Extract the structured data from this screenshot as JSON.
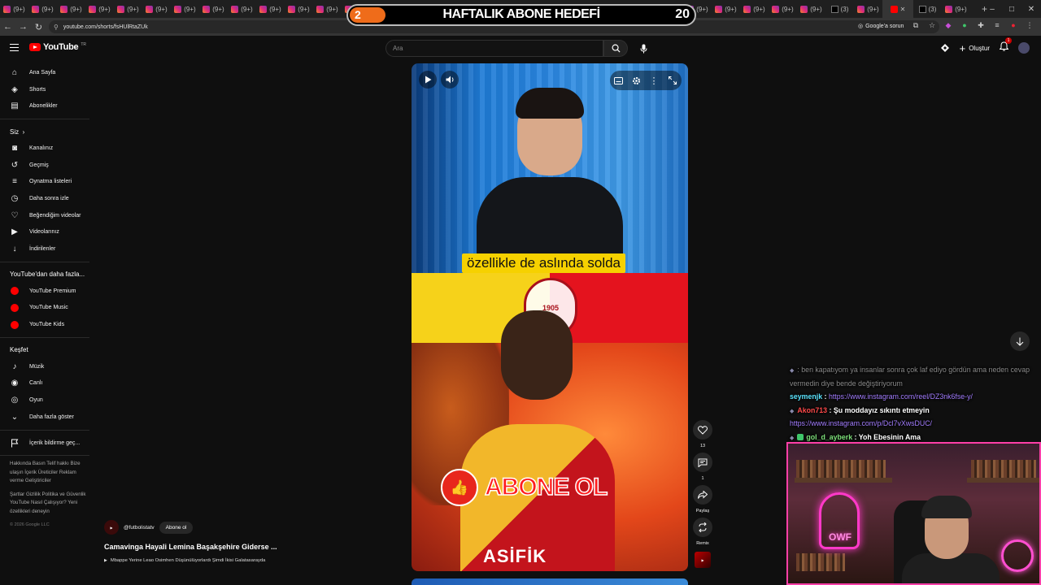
{
  "browser": {
    "tabs_count_label": "(9+)",
    "x_tab_label": "(3)",
    "url": "youtube.com/shorts/fsHUlRtaZUk",
    "google_issue": "Google'a sorun"
  },
  "overlay": {
    "goal_title": "HAFTALIK ABONE HEDEFİ",
    "current": "2",
    "target": "20"
  },
  "header": {
    "logo_text": "YouTube",
    "region": "TR",
    "search_placeholder": "Ara",
    "create_label": "Oluştur",
    "notif_count": "1"
  },
  "sidebar": {
    "main": [
      {
        "label": "Ana Sayfa",
        "icon": "home-icon"
      },
      {
        "label": "Shorts",
        "icon": "shorts-icon"
      },
      {
        "label": "Abonelikler",
        "icon": "subscriptions-icon"
      }
    ],
    "you_heading": "Siz",
    "you": [
      {
        "label": "Kanalınız",
        "icon": "channel-icon"
      },
      {
        "label": "Geçmiş",
        "icon": "history-icon"
      },
      {
        "label": "Oynatma listeleri",
        "icon": "playlist-icon"
      },
      {
        "label": "Daha sonra izle",
        "icon": "clock-icon"
      },
      {
        "label": "Beğendiğim videolar",
        "icon": "like-icon"
      },
      {
        "label": "Videolarınız",
        "icon": "video-icon"
      },
      {
        "label": "İndirilenler",
        "icon": "download-icon"
      }
    ],
    "more_heading": "YouTube'dan daha fazla...",
    "more": [
      {
        "label": "YouTube Premium"
      },
      {
        "label": "YouTube Music"
      },
      {
        "label": "YouTube Kids"
      }
    ],
    "explore_heading": "Keşfet",
    "explore": [
      {
        "label": "Müzik",
        "icon": "music-icon"
      },
      {
        "label": "Canlı",
        "icon": "live-icon"
      },
      {
        "label": "Oyun",
        "icon": "gaming-icon"
      },
      {
        "label": "Daha fazla göster",
        "icon": "chevron-down-icon"
      }
    ],
    "report_label": "İçerik bildirme geç...",
    "footer1": "Hakkında  Basın  Telif hakkı  Bize ulaşın  İçerik Üreticiler  Reklam verme  Geliştiriciler",
    "footer2": "Şartlar  Gizlilik  Politika ve Güvenlik  YouTube Nasıl Çalışıyor?  Yeni özellikleri deneyin",
    "copyright": "© 2026 Google LLC"
  },
  "video": {
    "subtitle": "özellikle de aslında solda",
    "cta": "ABONE OL",
    "sponsor": "ASİFİK",
    "club_year": "1905"
  },
  "actions": {
    "likes": "13",
    "comments": "1",
    "share": "Paylaş",
    "remix": "Remix"
  },
  "meta": {
    "handle": "@futbolistatv",
    "subscribe": "Abone ol",
    "title": "Camavinga Hayali Lemina Başakşehire Giderse ...",
    "related": "Mbappe Yerine Leao Osimhen Düşünülüyorlardı Şimdi İkisi Galatasarayda"
  },
  "chat": {
    "m1_text": ": ben kapatıyom ya insanlar sonra çok laf ediyo gördün ama neden cevap vermedin diye bende değiştiriyorum",
    "m2_user": "seymenjk",
    "m2_sep": " : ",
    "m2_link": "https://www.instagram.com/reel/DZ3nk6fse-y/",
    "m3_user": "Akon713",
    "m3_text": " : Şu moddayız sıkıntı etmeyin",
    "m3_link": "https://www.instagram.com/p/Dcl7vXwsDUC/",
    "m4_user": "gol_d_ayberk",
    "m4_text": " : Yoh Ebesinin Ama"
  },
  "webcam": {
    "neon_sign": "OWF"
  },
  "colors": {
    "accent": "#ff0000",
    "goal_fill": "#ef6c1a",
    "chat_link": "#a37dff",
    "webcam_border": "#ff3fa8"
  }
}
